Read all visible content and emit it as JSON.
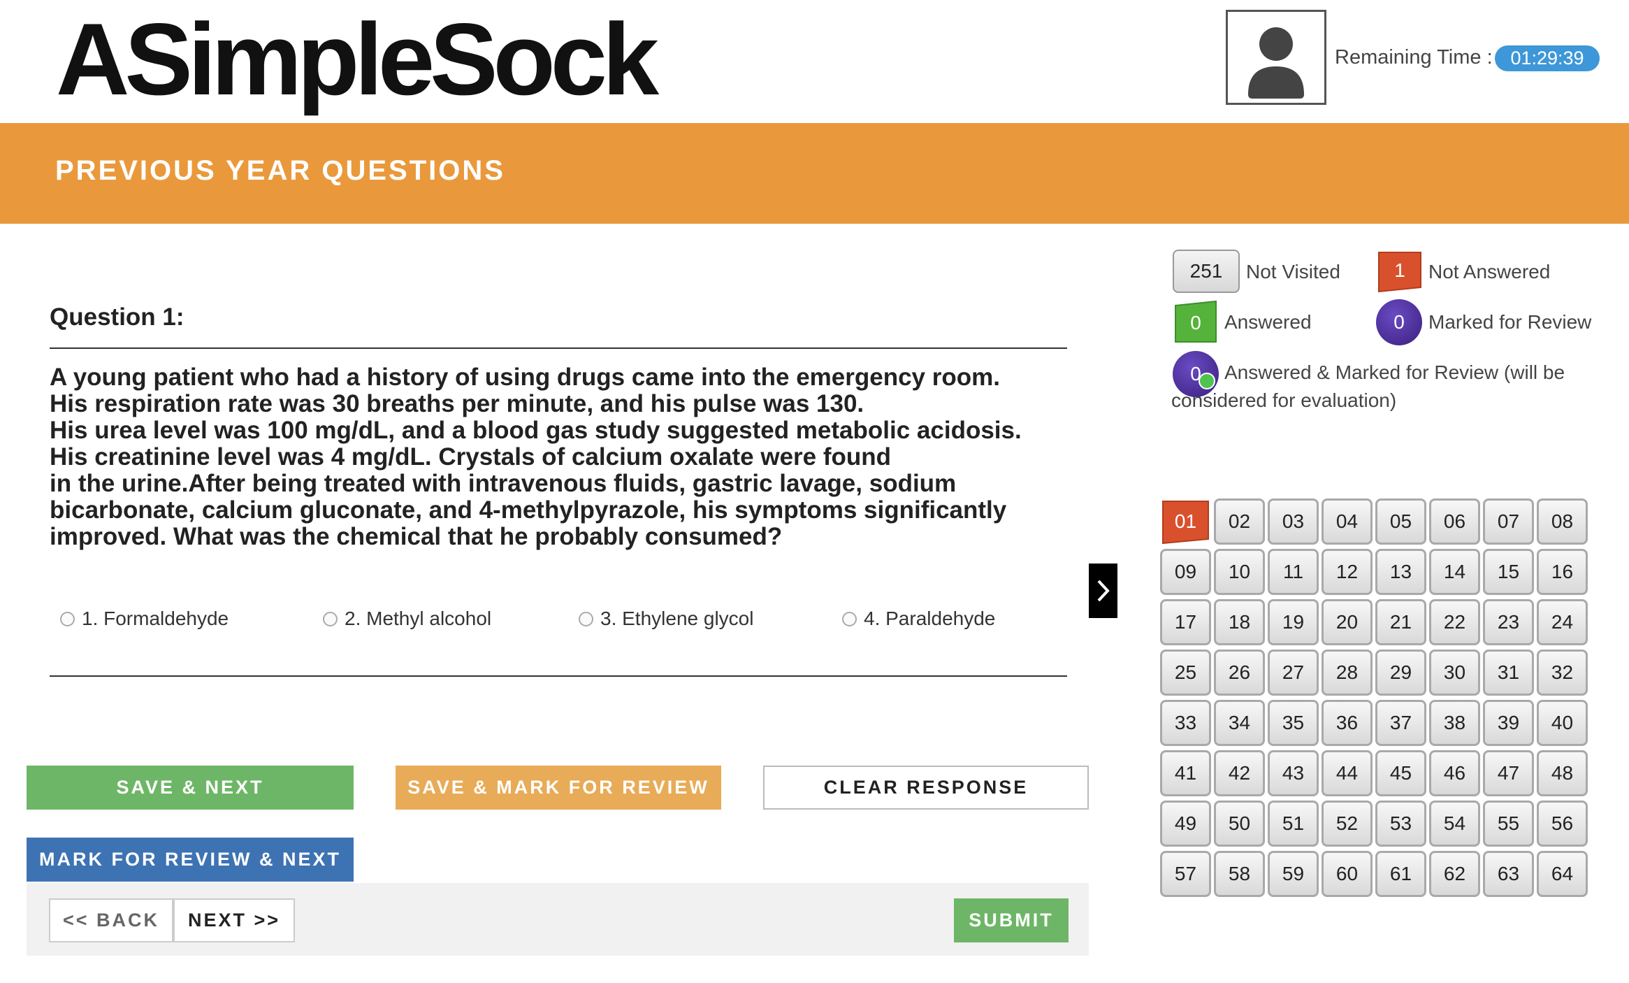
{
  "header": {
    "logo_text": "ASimpleSock",
    "timer_label": "Remaining Time :",
    "timer_value": "01:29:39"
  },
  "banner": {
    "title": "PREVIOUS YEAR QUESTIONS"
  },
  "question": {
    "heading": "Question 1:",
    "lines": [
      "A young patient who had a history of using drugs came into the emergency room.",
      "His respiration rate was 30 breaths per minute, and his pulse was 130.",
      "His urea level was 100 mg/dL, and a blood gas study suggested metabolic acidosis.",
      "His creatinine level was 4 mg/dL. Crystals of calcium oxalate were found",
      "in the urine.After being treated with intravenous fluids, gastric lavage, sodium",
      "bicarbonate, calcium gluconate, and 4-methylpyrazole, his symptoms significantly",
      "improved. What was the chemical that he probably consumed?"
    ],
    "options": [
      "1.  Formaldehyde",
      "2. Methyl alcohol",
      "3. Ethylene glycol",
      "4. Paraldehyde"
    ]
  },
  "buttons": {
    "save_next": "SAVE & NEXT",
    "save_mark_review": "SAVE & MARK FOR REVIEW",
    "clear_response": "CLEAR RESPONSE",
    "mark_review_next": "MARK FOR REVIEW & NEXT",
    "back": "<< BACK",
    "next": "NEXT >>",
    "submit": "SUBMIT"
  },
  "legend": {
    "not_visited": {
      "count": "251",
      "label": "Not Visited"
    },
    "not_answered": {
      "count": "1",
      "label": "Not Answered"
    },
    "answered": {
      "count": "0",
      "label": "Answered"
    },
    "marked_review": {
      "count": "0",
      "label": "Marked for Review"
    },
    "answered_marked": {
      "count": "0",
      "label_line1": "Answered & Marked for Review (will be",
      "label_line2": "considered for evaluation)"
    }
  },
  "palette": {
    "current": "01",
    "items": [
      "01",
      "02",
      "03",
      "04",
      "05",
      "06",
      "07",
      "08",
      "09",
      "10",
      "11",
      "12",
      "13",
      "14",
      "15",
      "16",
      "17",
      "18",
      "19",
      "20",
      "21",
      "22",
      "23",
      "24",
      "25",
      "26",
      "27",
      "28",
      "29",
      "30",
      "31",
      "32",
      "33",
      "34",
      "35",
      "36",
      "37",
      "38",
      "39",
      "40",
      "41",
      "42",
      "43",
      "44",
      "45",
      "46",
      "47",
      "48",
      "49",
      "50",
      "51",
      "52",
      "53",
      "54",
      "55",
      "56",
      "57",
      "58",
      "59",
      "60",
      "61",
      "62",
      "63",
      "64"
    ]
  },
  "colors": {
    "banner": "#e9993c",
    "timer_badge": "#3d97d8",
    "save_next": "#6eb667",
    "save_mark": "#e8ab58",
    "mark_next": "#3e73b3",
    "not_answered": "#d9512c",
    "answered": "#55b33b",
    "marked": "#4b2f9e"
  }
}
